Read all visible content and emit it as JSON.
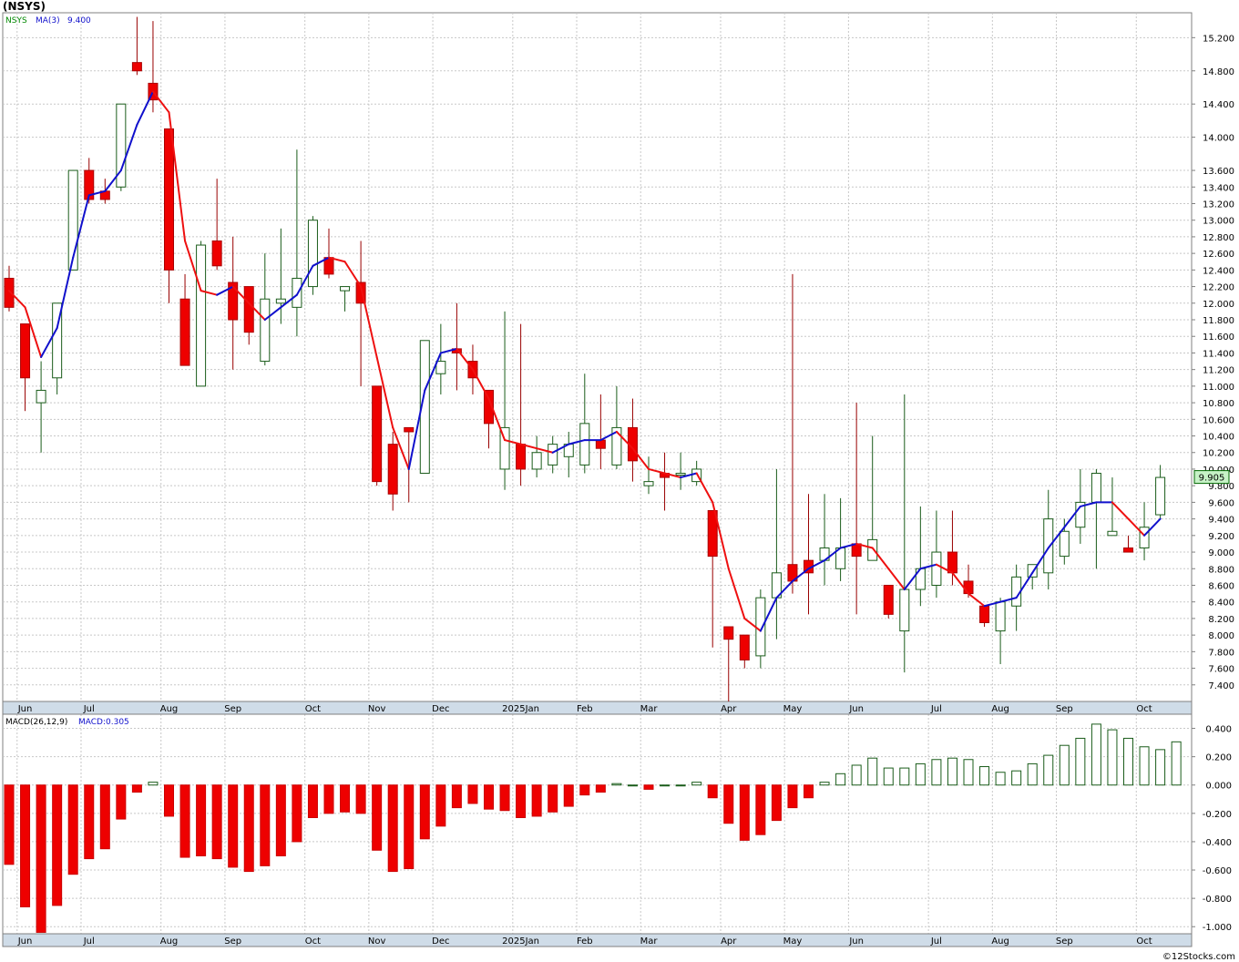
{
  "title": "(NSYS)",
  "credit": "©12Stocks.com",
  "colors": {
    "up": "#1a5c1a",
    "down": "#ee0000",
    "ma_up": "#1010cc",
    "ma_down": "#ee1010",
    "grid": "#c8c8c8",
    "axis_band": "#cfdce8",
    "last_price_bg": "#c6f2c6"
  },
  "chart_data": [
    {
      "type": "candlestick",
      "symbol_label": "NSYS",
      "indicator_label": "MA(3)",
      "indicator_value": "9.400",
      "last_price_label": "9.905",
      "last_price": 9.905,
      "ylim": [
        7.2,
        15.5
      ],
      "y_ticks": [
        7.4,
        7.6,
        7.8,
        8.0,
        8.2,
        8.4,
        8.6,
        8.8,
        9.0,
        9.2,
        9.4,
        9.6,
        9.8,
        10.0,
        10.2,
        10.4,
        10.6,
        10.8,
        11.0,
        11.2,
        11.4,
        11.6,
        11.8,
        12.0,
        12.2,
        12.4,
        12.6,
        12.8,
        13.0,
        13.2,
        13.4,
        13.6,
        14.0,
        14.4,
        14.8,
        15.2
      ],
      "y_tick_labels": [
        "7.400",
        "7.600",
        "7.800",
        "8.000",
        "8.200",
        "8.400",
        "8.600",
        "8.800",
        "9.000",
        "9.200",
        "9.400",
        "9.600",
        "9.800",
        "10.000",
        "10.200",
        "10.400",
        "10.600",
        "10.800",
        "11.000",
        "11.200",
        "11.400",
        "11.600",
        "11.800",
        "12.000",
        "12.200",
        "12.400",
        "12.600",
        "12.800",
        "13.000",
        "13.200",
        "13.400",
        "13.600",
        "14.000",
        "14.400",
        "14.800",
        "15.200"
      ],
      "month_labels": [
        "Jun",
        "Jul",
        "Aug",
        "Sep",
        "Oct",
        "Nov",
        "Dec",
        "2025Jan",
        "Feb",
        "Mar",
        "Apr",
        "May",
        "Jun",
        "Jul",
        "Aug",
        "Sep",
        "Oct"
      ],
      "month_label_index": [
        1,
        5,
        10,
        14,
        19,
        23,
        27,
        32,
        36,
        40,
        45,
        49,
        53,
        58,
        62,
        66,
        71
      ],
      "ohlc": [
        [
          12.3,
          12.45,
          11.9,
          11.95
        ],
        [
          11.75,
          11.75,
          10.7,
          11.1
        ],
        [
          10.8,
          11.3,
          10.2,
          10.95
        ],
        [
          11.1,
          12.0,
          10.9,
          12.0
        ],
        [
          12.4,
          13.6,
          13.0,
          13.6
        ],
        [
          13.6,
          13.75,
          13.2,
          13.25
        ],
        [
          13.35,
          13.5,
          13.2,
          13.25
        ],
        [
          13.4,
          14.4,
          13.35,
          14.4
        ],
        [
          14.9,
          15.45,
          14.75,
          14.8
        ],
        [
          14.65,
          15.4,
          14.3,
          14.45
        ],
        [
          14.1,
          14.1,
          12.0,
          12.4
        ],
        [
          12.05,
          12.35,
          11.25,
          11.25
        ],
        [
          11.0,
          12.75,
          11.0,
          12.7
        ],
        [
          12.75,
          13.5,
          12.4,
          12.45
        ],
        [
          12.25,
          12.8,
          11.2,
          11.8
        ],
        [
          12.2,
          12.2,
          11.5,
          11.65
        ],
        [
          11.3,
          12.6,
          11.25,
          12.05
        ],
        [
          12.0,
          12.9,
          11.75,
          12.05
        ],
        [
          11.95,
          13.85,
          11.6,
          12.3
        ],
        [
          12.2,
          13.05,
          12.1,
          13.0
        ],
        [
          12.55,
          12.9,
          12.3,
          12.35
        ],
        [
          12.15,
          12.15,
          11.9,
          12.2
        ],
        [
          12.25,
          12.75,
          11.0,
          12.0
        ],
        [
          11.0,
          11.0,
          9.8,
          9.85
        ],
        [
          10.3,
          10.45,
          9.5,
          9.7
        ],
        [
          10.5,
          10.5,
          9.6,
          10.45
        ],
        [
          9.95,
          11.55,
          9.95,
          11.55
        ],
        [
          11.15,
          11.75,
          10.9,
          11.3
        ],
        [
          11.45,
          12.0,
          10.95,
          11.4
        ],
        [
          11.3,
          11.5,
          10.9,
          11.1
        ],
        [
          10.95,
          10.95,
          10.25,
          10.55
        ],
        [
          10.0,
          11.9,
          9.75,
          10.5
        ],
        [
          10.3,
          11.75,
          9.8,
          10.0
        ],
        [
          10.0,
          10.4,
          9.9,
          10.2
        ],
        [
          10.05,
          10.4,
          9.95,
          10.3
        ],
        [
          10.15,
          10.45,
          9.9,
          10.3
        ],
        [
          10.05,
          11.15,
          9.95,
          10.55
        ],
        [
          10.35,
          10.9,
          10.0,
          10.25
        ],
        [
          10.05,
          11.0,
          10.0,
          10.5
        ],
        [
          10.5,
          10.85,
          9.85,
          10.1
        ],
        [
          9.8,
          10.15,
          9.7,
          9.85
        ],
        [
          9.95,
          10.2,
          9.5,
          9.9
        ],
        [
          9.95,
          10.2,
          9.75,
          9.95
        ],
        [
          9.85,
          10.1,
          9.8,
          10.0
        ],
        [
          9.5,
          9.5,
          7.85,
          8.95
        ],
        [
          8.1,
          8.1,
          7.2,
          7.95
        ],
        [
          8.0,
          8.0,
          7.6,
          7.7
        ],
        [
          7.75,
          8.55,
          7.6,
          8.45
        ],
        [
          8.45,
          10.0,
          7.95,
          8.75
        ],
        [
          8.85,
          12.35,
          8.5,
          8.65
        ],
        [
          8.9,
          9.7,
          8.25,
          8.75
        ],
        [
          8.9,
          9.7,
          8.6,
          9.05
        ],
        [
          8.8,
          9.65,
          8.65,
          9.05
        ],
        [
          9.1,
          10.8,
          8.25,
          8.95
        ],
        [
          8.9,
          10.4,
          8.9,
          9.15
        ],
        [
          8.6,
          8.6,
          8.2,
          8.25
        ],
        [
          8.05,
          10.9,
          7.55,
          8.55
        ],
        [
          8.55,
          9.55,
          8.35,
          8.8
        ],
        [
          8.6,
          9.5,
          8.45,
          9.0
        ],
        [
          9.0,
          9.5,
          8.6,
          8.75
        ],
        [
          8.65,
          8.85,
          8.45,
          8.5
        ],
        [
          8.35,
          8.35,
          8.1,
          8.15
        ],
        [
          8.05,
          8.45,
          7.65,
          8.4
        ],
        [
          8.35,
          8.85,
          8.05,
          8.7
        ],
        [
          8.7,
          8.85,
          8.55,
          8.85
        ],
        [
          8.75,
          9.75,
          8.55,
          9.4
        ],
        [
          8.95,
          9.4,
          8.85,
          9.25
        ],
        [
          9.3,
          10.0,
          9.1,
          9.6
        ],
        [
          9.6,
          10.0,
          8.8,
          9.95
        ],
        [
          9.2,
          9.9,
          9.2,
          9.25
        ],
        [
          9.05,
          9.2,
          9.0,
          9.0
        ],
        [
          9.05,
          9.6,
          8.9,
          9.3
        ],
        [
          9.45,
          10.05,
          9.4,
          9.9
        ]
      ],
      "ma3": [
        12.15,
        11.95,
        11.35,
        11.7,
        12.55,
        13.3,
        13.35,
        13.6,
        14.15,
        14.55,
        14.3,
        12.75,
        12.15,
        12.1,
        12.2,
        12.0,
        11.8,
        11.95,
        12.1,
        12.45,
        12.55,
        12.5,
        12.2,
        11.35,
        10.5,
        10.0,
        10.95,
        11.4,
        11.45,
        11.2,
        10.85,
        10.35,
        10.3,
        10.25,
        10.2,
        10.3,
        10.35,
        10.35,
        10.45,
        10.25,
        10.0,
        9.95,
        9.9,
        9.95,
        9.6,
        8.8,
        8.2,
        8.05,
        8.45,
        8.65,
        8.8,
        8.9,
        9.05,
        9.1,
        9.05,
        8.8,
        8.55,
        8.8,
        8.85,
        8.75,
        8.5,
        8.35,
        8.4,
        8.45,
        8.75,
        9.05,
        9.3,
        9.55,
        9.6,
        9.6,
        9.4,
        9.2,
        9.4
      ]
    },
    {
      "type": "bar",
      "indicator_label": "MACD(26,12,9)",
      "value_label": "MACD:0.305",
      "ylim": [
        -1.05,
        0.5
      ],
      "y_ticks": [
        0.4,
        0.2,
        0.0,
        -0.2,
        -0.4,
        -0.6,
        -0.8,
        -1.0
      ],
      "y_tick_labels": [
        "0.400",
        "0.200",
        "0.000",
        "-0.200",
        "-0.400",
        "-0.600",
        "-0.800",
        "-1.000"
      ],
      "values": [
        -0.56,
        -0.86,
        -1.04,
        -0.85,
        -0.63,
        -0.52,
        -0.45,
        -0.24,
        -0.05,
        0.02,
        -0.22,
        -0.51,
        -0.5,
        -0.52,
        -0.58,
        -0.61,
        -0.57,
        -0.5,
        -0.4,
        -0.23,
        -0.2,
        -0.19,
        -0.2,
        -0.46,
        -0.61,
        -0.59,
        -0.38,
        -0.29,
        -0.16,
        -0.13,
        -0.17,
        -0.18,
        -0.23,
        -0.22,
        -0.19,
        -0.15,
        -0.07,
        -0.05,
        0.01,
        0.0,
        -0.03,
        0.0,
        0.0,
        0.02,
        -0.09,
        -0.27,
        -0.39,
        -0.35,
        -0.25,
        -0.16,
        -0.09,
        0.02,
        0.08,
        0.14,
        0.19,
        0.12,
        0.12,
        0.15,
        0.18,
        0.19,
        0.18,
        0.13,
        0.09,
        0.1,
        0.15,
        0.21,
        0.28,
        0.33,
        0.43,
        0.39,
        0.33,
        0.27,
        0.25,
        0.305
      ]
    }
  ]
}
